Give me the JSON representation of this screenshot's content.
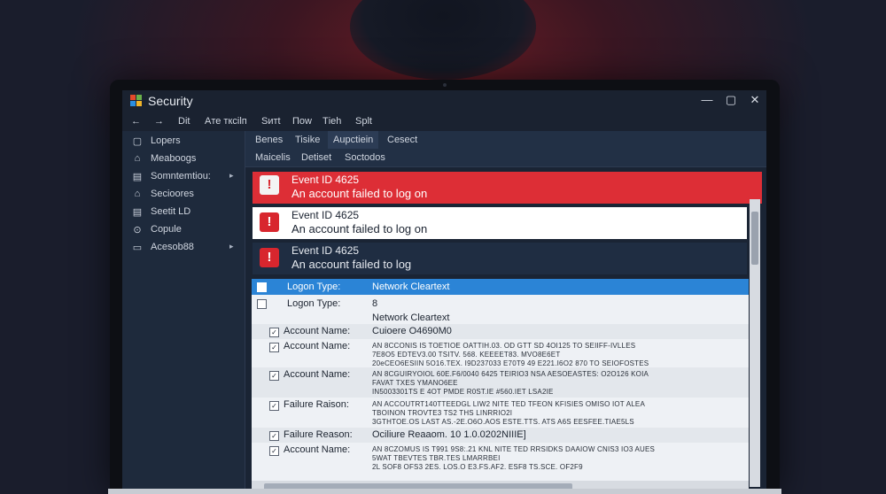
{
  "window": {
    "title": "Security",
    "controls": {
      "minimize": "—",
      "maximize": "▢",
      "close": "✕"
    }
  },
  "menu": [
    {
      "label": "←"
    },
    {
      "label": "→"
    },
    {
      "label": "Dit"
    },
    {
      "label": "Aте тксіlп"
    },
    {
      "label": "Sитt"
    },
    {
      "label": "Поw"
    },
    {
      "label": "Тiеh"
    },
    {
      "label": "Sрlt"
    }
  ],
  "sidebar": {
    "items": [
      {
        "icon": "folder-icon",
        "glyph": "▢",
        "label": "Lopers"
      },
      {
        "icon": "home-icon",
        "glyph": "⌂",
        "label": "Meaboogs"
      },
      {
        "icon": "doc-icon",
        "glyph": "▤",
        "label": "Somntemtiou:",
        "arrow": "▸"
      },
      {
        "icon": "shield-icon",
        "glyph": "⌂",
        "label": "Secioores"
      },
      {
        "icon": "settings-icon",
        "glyph": "▤",
        "label": "Seetit LD"
      },
      {
        "icon": "copy-icon",
        "glyph": "⊙",
        "label": "Copule"
      },
      {
        "icon": "access-icon",
        "glyph": "▭",
        "label": "Acesob88",
        "arrow": "▸"
      }
    ]
  },
  "tabs1": [
    {
      "label": "Benes"
    },
    {
      "label": "Tisike"
    },
    {
      "label": "Aupctiein",
      "active": true
    },
    {
      "label": "Cesect"
    }
  ],
  "tabs2": [
    {
      "label": "Maicelis"
    },
    {
      "label": "Detiset"
    },
    {
      "label": "Soctodos"
    }
  ],
  "events": [
    {
      "icon": "!",
      "id": "Event ID 4625",
      "message": "An account failed to log on",
      "style": "red"
    },
    {
      "icon": "!",
      "id": "Event ID 4625",
      "message": "An account failed to log on",
      "style": "white"
    },
    {
      "icon": "!",
      "id": "Event ID 4625",
      "message": "An account failed to log",
      "style": "dark"
    }
  ],
  "details": {
    "selected": {
      "label": "Logon Type:",
      "value": "Network Cleartext"
    },
    "logon_type": {
      "label": "Logon Type:",
      "value": "8",
      "sub": "Network Cleartext"
    },
    "rows": [
      {
        "label": "Account Name:",
        "lines": [
          "Cuioere O4690M0"
        ]
      },
      {
        "label": "Account Name:",
        "lines": [
          "AN 8CCONIS IS TOETIOE OATTIH.03. OD GTT SD 4OI125 TO SEIIFF-IVLLES",
          "7E8O5 EDTEV3.00 TSITV. 568. KEEEET83. MVO8E6ET",
          "20eCEO6ESIIN 5O16.TEX. I9D237033 E70T9 49 E221.I6O2 870 TO SEIOFOSTES"
        ]
      },
      {
        "label": "Account Name:",
        "lines": [
          "AN 8CGUIRYOIOL 60E.F6/0040 6425 TEIRIO3 NSA AESOEASTES: O2O126 KOIA",
          "FAVAT TXES YMANO6EE",
          "IN5003301TS E 4OT PMDE R0ST.IE #560.IET LSA2IE"
        ]
      },
      {
        "label": "Failure Raison:",
        "lines": [
          "AN ACCOUTRT140TTEEDGL LIW2 NITE TED TFEON KFISIES OMISO IOT ALEA",
          "TBOINON TROVTE3 TS2 THS LINRRIO2I",
          "3GTHTOE.OS LAST AS.-2E.O6O.AOS ESTE.TTS. ATS A6S EESFEE.TIAE5LS"
        ]
      },
      {
        "label": "Failure Reason:",
        "lines": [
          "Ociliure Reaaom. 10 1.0.0202NIIIE]"
        ]
      },
      {
        "label": "Account Name:",
        "lines": [
          "AN 8CZOMUS IS T991 9S8:.21 KNL NITE TED RRSIDKS DAAIOW CNIS3 IO3 AUES",
          "5WAT TBEVTES TBR.TES LMARRBEI",
          "2L SOF8 OFS3 2ES. LOS.O E3.FS.AF2. ESF8 TS.SCE. OF2F9"
        ]
      }
    ],
    "checkbox_glyph": "✓"
  }
}
